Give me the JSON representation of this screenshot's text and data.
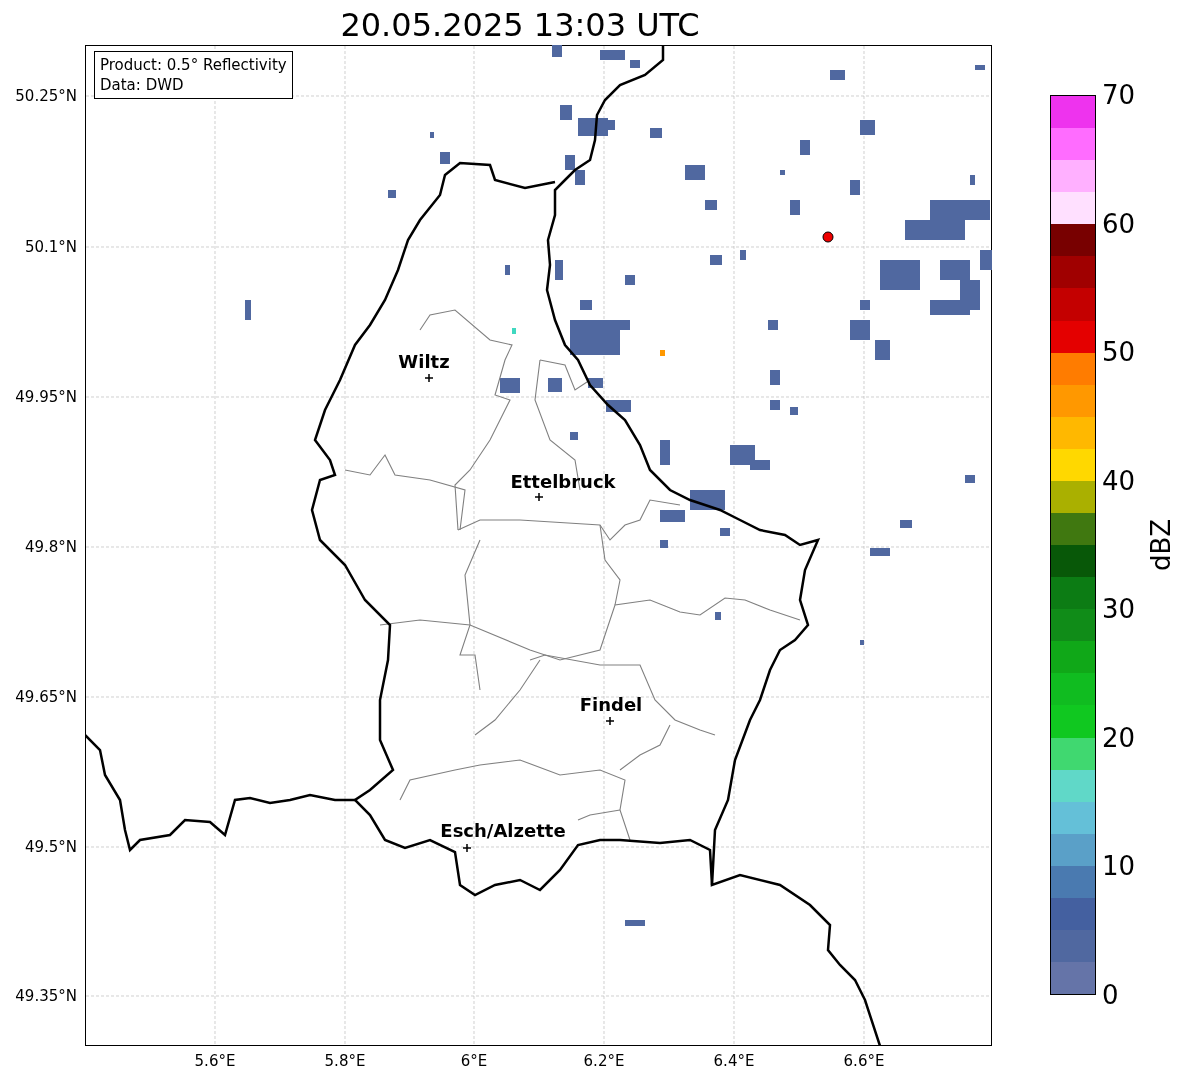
{
  "title": "20.05.2025 13:03 UTC",
  "legend": {
    "lines": [
      "Product: 0.5° Reflectivity",
      "Data: DWD"
    ]
  },
  "y_ticks": [
    "50.25°N",
    "50.1°N",
    "49.95°N",
    "49.8°N",
    "49.65°N",
    "49.5°N",
    "49.35°N"
  ],
  "x_ticks": [
    "5.6°E",
    "5.8°E",
    "6°E",
    "6.2°E",
    "6.4°E",
    "6.6°E"
  ],
  "places": [
    {
      "name": "Wiltz"
    },
    {
      "name": "Ettelbruck"
    },
    {
      "name": "Findel"
    },
    {
      "name": "Esch/Alzette"
    }
  ],
  "colorbar": {
    "label": "dBZ",
    "ticks": [
      "70",
      "60",
      "50",
      "40",
      "30",
      "20",
      "10",
      "0"
    ],
    "bands": [
      {
        "color": "#ee33ee"
      },
      {
        "color": "#ff6cff"
      },
      {
        "color": "#ffb0ff"
      },
      {
        "color": "#ffe0ff"
      },
      {
        "color": "#780000"
      },
      {
        "color": "#a00000"
      },
      {
        "color": "#c40000"
      },
      {
        "color": "#e40000"
      },
      {
        "color": "#ff7c00"
      },
      {
        "color": "#ff9800"
      },
      {
        "color": "#ffb800"
      },
      {
        "color": "#ffd800"
      },
      {
        "color": "#aab000"
      },
      {
        "color": "#407810"
      },
      {
        "color": "#085808"
      },
      {
        "color": "#0c7c14"
      },
      {
        "color": "#108c18"
      },
      {
        "color": "#10a818"
      },
      {
        "color": "#10bc20"
      },
      {
        "color": "#10c820"
      },
      {
        "color": "#40d870"
      },
      {
        "color": "#60d8c8"
      },
      {
        "color": "#64c0d8"
      },
      {
        "color": "#5aa0c8"
      },
      {
        "color": "#4a7ab0"
      },
      {
        "color": "#4460a0"
      },
      {
        "color": "#5068a0"
      },
      {
        "color": "#6574a8"
      }
    ]
  }
}
